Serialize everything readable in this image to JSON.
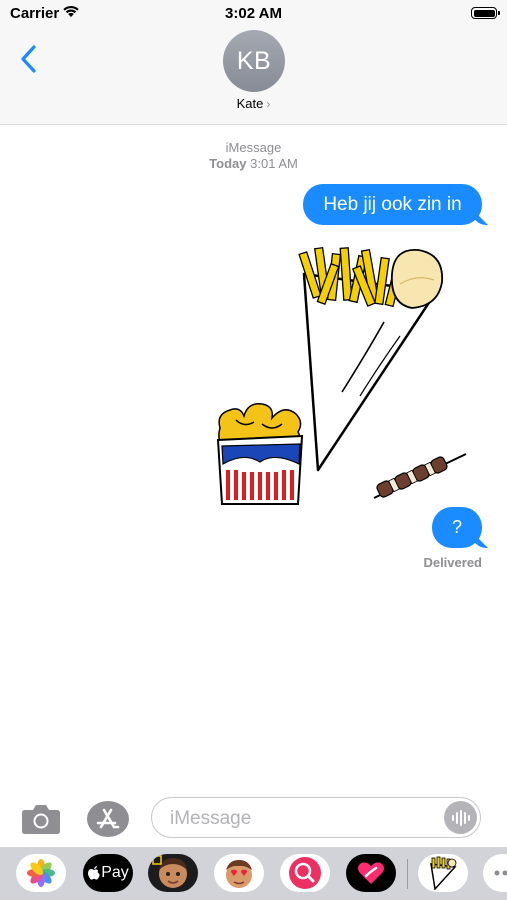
{
  "status_bar": {
    "carrier": "Carrier",
    "time": "3:02 AM"
  },
  "header": {
    "avatar_initials": "KB",
    "contact_name": "Kate",
    "chevron": "›"
  },
  "conversation": {
    "service": "iMessage",
    "timestamp_day": "Today",
    "timestamp_time": "3:01 AM",
    "messages": [
      {
        "text": "Heb jij ook zin in",
        "sender": "me"
      },
      {
        "type": "stickers",
        "items": [
          "fries-cone-sticker",
          "fries-box-sticker",
          "kebab-skewer-sticker"
        ]
      },
      {
        "text": "?",
        "sender": "me"
      }
    ],
    "status": "Delivered"
  },
  "composer": {
    "placeholder": "iMessage",
    "value": ""
  },
  "app_drawer": {
    "apps": [
      "photos-icon",
      "apple-pay-icon",
      "memoji-icon",
      "animoji-icon",
      "web-search-icon",
      "digital-touch-icon",
      "fries-sticker-app-icon",
      "more-icon"
    ],
    "apple_pay_label": "Pay"
  },
  "colors": {
    "bubble": "#1a8cff",
    "nav_background": "#f7f7f7",
    "drawer_background": "#d1d3d9",
    "meta_text": "#8e8e93"
  }
}
